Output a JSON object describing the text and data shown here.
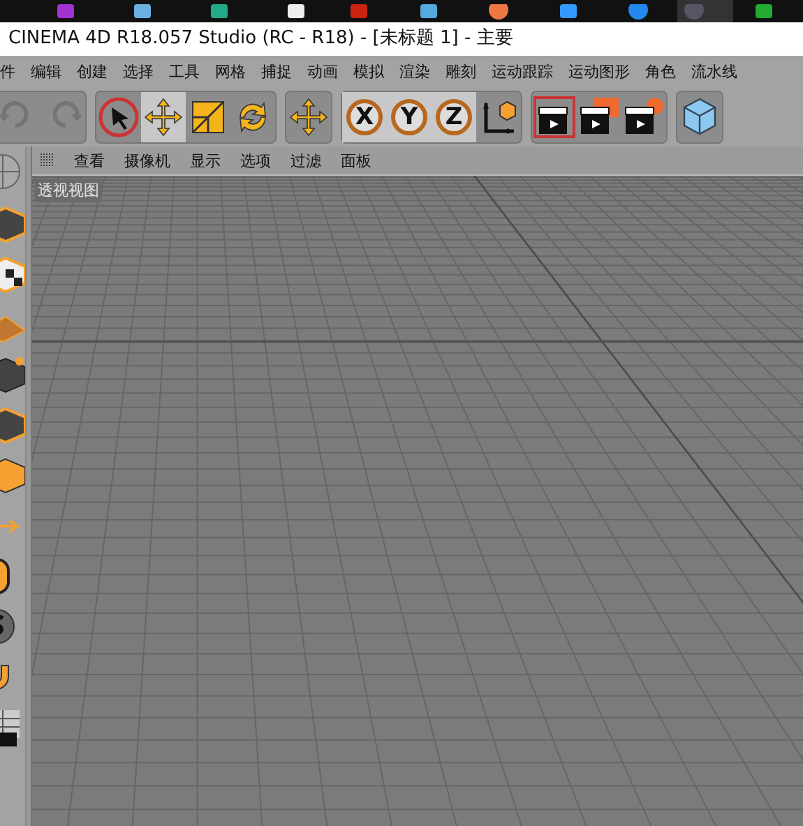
{
  "window": {
    "title": "CINEMA 4D R18.057 Studio (RC - R18) - [未标题 1] - 主要"
  },
  "menu": [
    "件",
    "编辑",
    "创建",
    "选择",
    "工具",
    "网格",
    "捕捉",
    "动画",
    "模拟",
    "渲染",
    "雕刻",
    "运动跟踪",
    "运动图形",
    "角色",
    "流水线"
  ],
  "toolbar": [
    {
      "group": [
        {
          "kind": "undo",
          "disabled": true
        },
        {
          "kind": "redo",
          "disabled": true
        }
      ]
    },
    {
      "group": [
        {
          "kind": "select",
          "selected": false
        },
        {
          "kind": "move",
          "selected": true
        },
        {
          "kind": "scale",
          "selected": false
        },
        {
          "kind": "rotate",
          "selected": false
        }
      ]
    },
    {
      "group": [
        {
          "kind": "move",
          "selected": false
        }
      ]
    },
    {
      "group": [
        {
          "kind": "axis",
          "label": "X",
          "selected": true
        },
        {
          "kind": "axis",
          "label": "Y",
          "selected": true
        },
        {
          "kind": "axis",
          "label": "Z",
          "selected": true
        },
        {
          "kind": "coords",
          "selected": false
        }
      ]
    },
    {
      "group": [
        {
          "kind": "render-view",
          "selected": false
        },
        {
          "kind": "render",
          "selected": false
        },
        {
          "kind": "render-settings",
          "selected": false
        }
      ]
    },
    {
      "group": [
        {
          "kind": "cube",
          "selected": false
        }
      ]
    }
  ],
  "viewport": {
    "menu": [
      "查看",
      "摄像机",
      "显示",
      "选项",
      "过滤",
      "面板"
    ],
    "label": "透视视图"
  }
}
